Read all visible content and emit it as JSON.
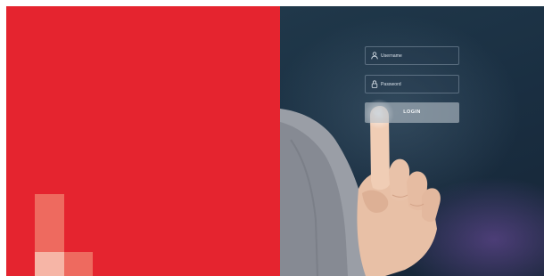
{
  "login": {
    "username_placeholder": "Username",
    "password_placeholder": "Password",
    "login_label": "LOGIN"
  },
  "colors": {
    "brand_red": "#e5242f",
    "block_light": "#f6b5a6",
    "block_mid": "#ee6a5f",
    "photo_bg": "#1a2f42"
  },
  "icons": {
    "username": "user-icon",
    "password": "lock-icon"
  }
}
